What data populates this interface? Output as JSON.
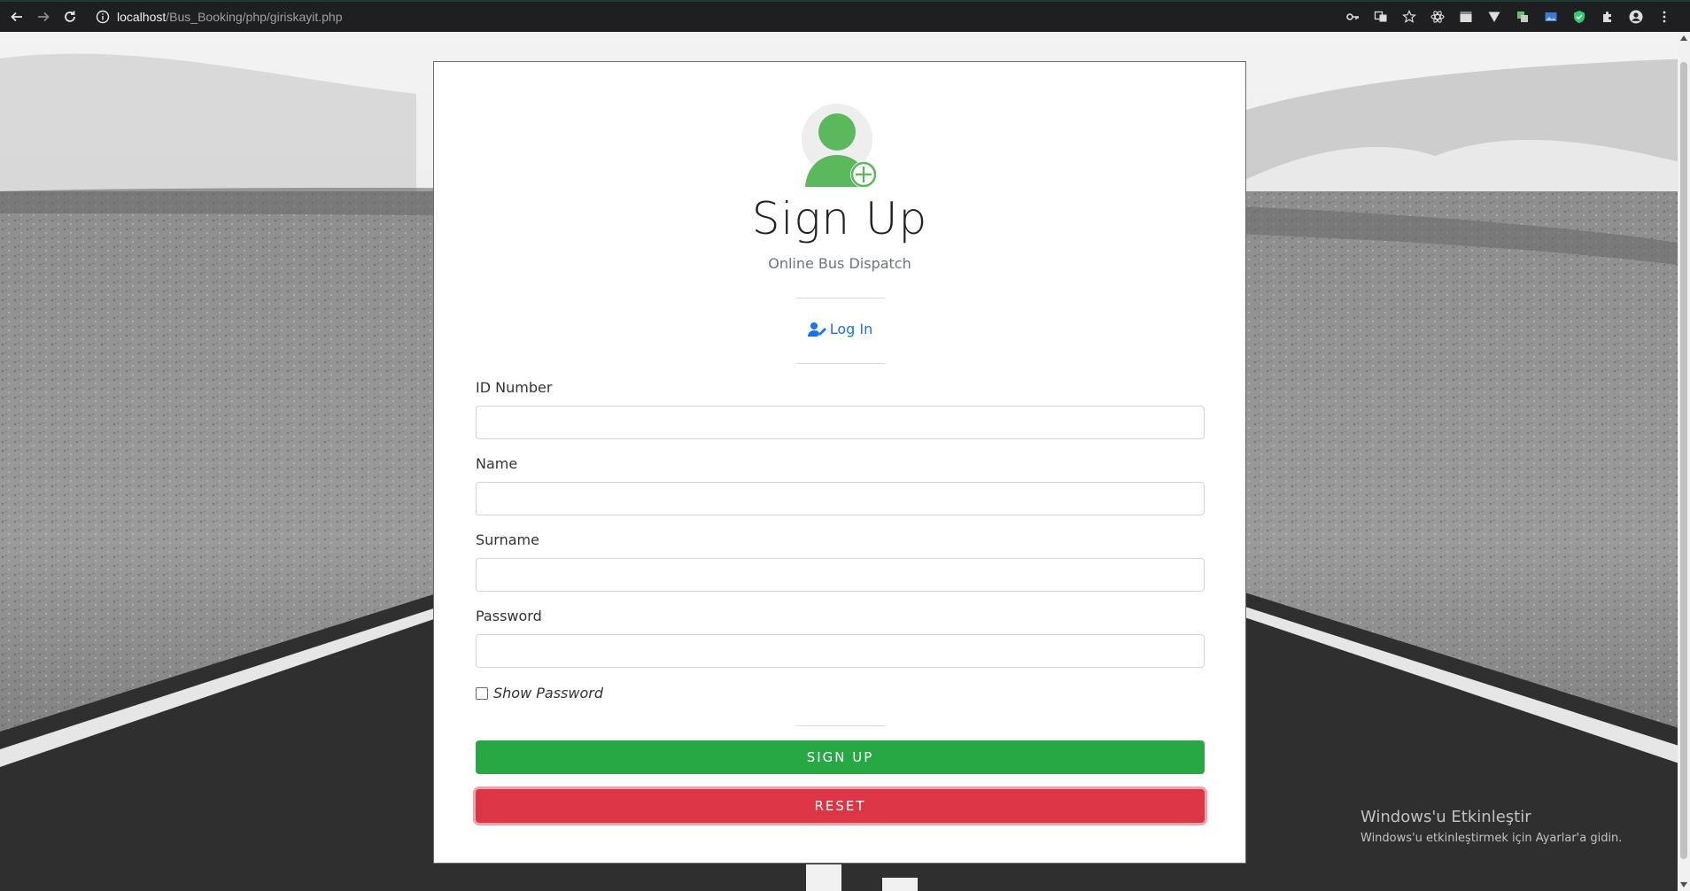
{
  "browser": {
    "url_host": "localhost",
    "url_path": "/Bus_Booking/php/giriskayit.php"
  },
  "card": {
    "title": "Sign Up",
    "subtitle": "Online Bus Dispatch",
    "login_link": "Log In",
    "fields": [
      {
        "label": "ID Number",
        "value": ""
      },
      {
        "label": "Name",
        "value": ""
      },
      {
        "label": "Surname",
        "value": ""
      },
      {
        "label": "Password",
        "value": ""
      }
    ],
    "show_password_label": "Show Password",
    "show_password_checked": false,
    "signup_button": "SIGN UP",
    "reset_button": "RESET"
  },
  "watermark": {
    "title": "Windows'u Etkinleştir",
    "subtitle": "Windows'u etkinleştirmek için Ayarlar'a gidin."
  },
  "colors": {
    "signup": "#28a745",
    "reset": "#dc3545",
    "link": "#1a73e8",
    "avatar": "#5cb85c"
  }
}
